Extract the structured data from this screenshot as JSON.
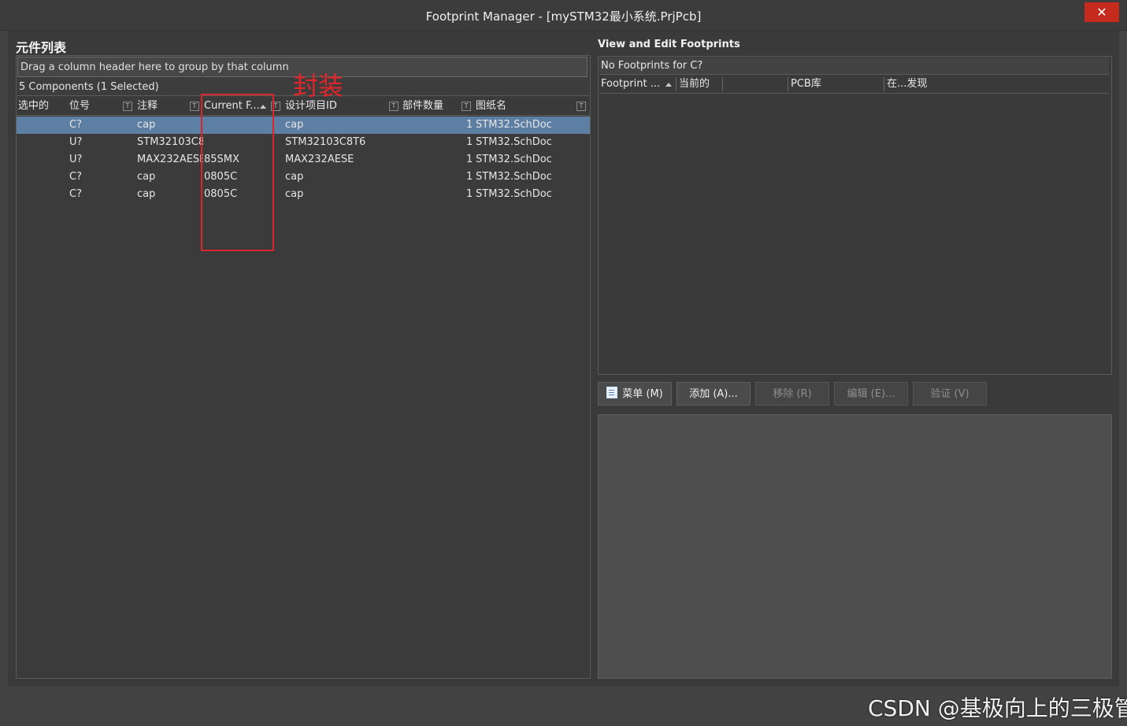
{
  "window": {
    "title": "Footprint Manager - [mySTM32最小系统.PrjPcb]",
    "close_glyph": "✕"
  },
  "left": {
    "title": "元件列表",
    "group_hint": "Drag a column header here to group by that column",
    "count_text": "5 Components (1 Selected)",
    "columns": [
      "选中的",
      "位号",
      "注释",
      "Current F...",
      "设计项目ID",
      "部件数量",
      "图纸名"
    ],
    "filter_glyph": "T",
    "rows": [
      {
        "selected": true,
        "designator": "C?",
        "comment": "cap",
        "footprint": "",
        "design_item_id": "cap",
        "part_count": "1",
        "sheet": "STM32.SchDoc"
      },
      {
        "selected": false,
        "designator": "U?",
        "comment": "STM32103C8",
        "footprint": "",
        "design_item_id": "STM32103C8T6",
        "part_count": "1",
        "sheet": "STM32.SchDoc"
      },
      {
        "selected": false,
        "designator": "U?",
        "comment": "MAX232AESE",
        "footprint": "85SMX",
        "design_item_id": "MAX232AESE",
        "part_count": "1",
        "sheet": "STM32.SchDoc"
      },
      {
        "selected": false,
        "designator": "C?",
        "comment": "cap",
        "footprint": "0805C",
        "design_item_id": "cap",
        "part_count": "1",
        "sheet": "STM32.SchDoc"
      },
      {
        "selected": false,
        "designator": "C?",
        "comment": "cap",
        "footprint": "0805C",
        "design_item_id": "cap",
        "part_count": "1",
        "sheet": "STM32.SchDoc"
      }
    ]
  },
  "annotation": {
    "text": "封装",
    "color": "#e0262a"
  },
  "right": {
    "title": "View and Edit Footprints",
    "no_footprints": "No Footprints for C?",
    "columns": [
      "Footprint ...",
      "当前的",
      "PCB库",
      "在...发现"
    ],
    "buttons": [
      {
        "label": "菜单 (M)",
        "enabled": true,
        "icon": "menu-icon"
      },
      {
        "label": "添加 (A)...",
        "enabled": true
      },
      {
        "label": "移除 (R)",
        "enabled": false
      },
      {
        "label": "编辑 (E)...",
        "enabled": false
      },
      {
        "label": "验证 (V)",
        "enabled": false
      }
    ]
  },
  "watermark": "CSDN @基极向上的三极管"
}
